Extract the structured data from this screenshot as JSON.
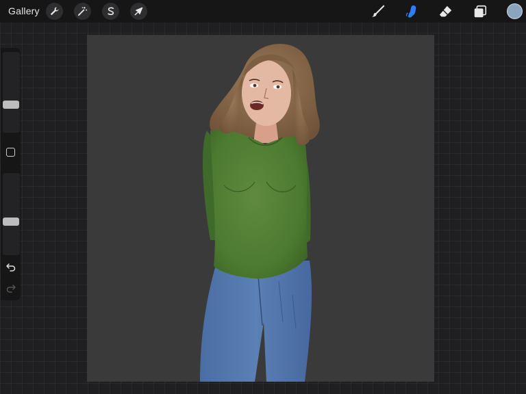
{
  "topbar": {
    "gallery_label": "Gallery",
    "left_tools": [
      {
        "name": "actions",
        "icon": "wrench-icon"
      },
      {
        "name": "adjustments",
        "icon": "magic-wand-icon"
      },
      {
        "name": "selection",
        "icon": "selection-s-icon"
      },
      {
        "name": "transform",
        "icon": "arrow-cursor-icon"
      }
    ],
    "right_tools": [
      {
        "name": "brush",
        "icon": "brush-icon",
        "active": false
      },
      {
        "name": "smudge",
        "icon": "smudge-finger-icon",
        "active": true
      },
      {
        "name": "eraser",
        "icon": "eraser-icon",
        "active": false
      },
      {
        "name": "layers",
        "icon": "layers-icon",
        "active": false
      }
    ],
    "current_color": "#8aa6bf"
  },
  "colors": {
    "accent": "#2f7df6",
    "canvas_bg": "#3a3a3a"
  },
  "sidebar": {
    "brush_size_level": 0.33,
    "opacity_level": 0.4,
    "modify_icon": "square-icon",
    "undo_icon": "undo-icon",
    "redo_icon": "redo-icon"
  }
}
